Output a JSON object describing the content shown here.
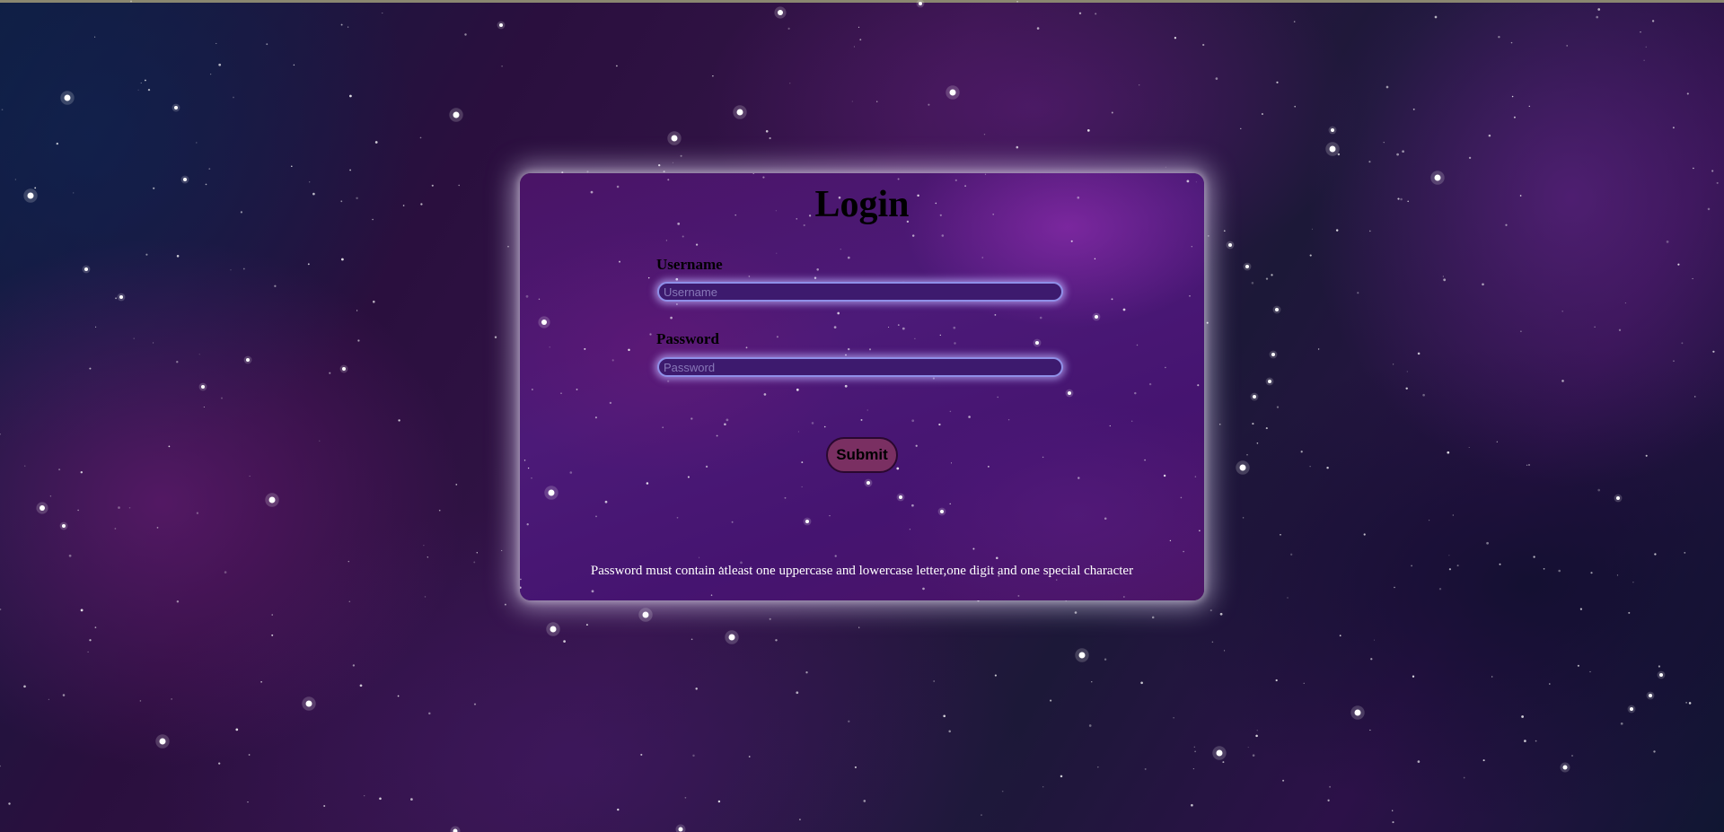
{
  "login_form": {
    "title": "Login",
    "username": {
      "label": "Username",
      "placeholder": "Username",
      "value": ""
    },
    "password": {
      "label": "Password",
      "placeholder": "Password",
      "value": ""
    },
    "submit_label": "Submit",
    "password_hint": "Password must contain atleast one uppercase and lowercase letter,one digit and one special character"
  },
  "colors": {
    "card_background": "#4a1870",
    "card_glow": "#ebe1ff",
    "input_border": "#8f8fe8",
    "input_background": "#3d1a6e",
    "submit_background": "#7a2f62",
    "heading_text": "#000000",
    "hint_text": "#ffffff"
  }
}
